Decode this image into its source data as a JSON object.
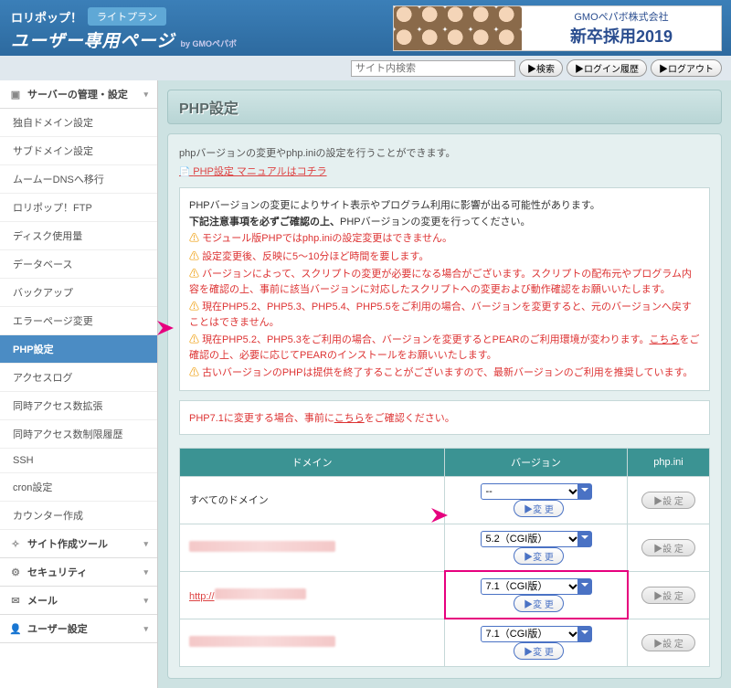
{
  "header": {
    "logo": "ロリポップ！",
    "plan": "ライトプラン",
    "subtitle": "ユーザー専用ページ",
    "byline": "by GMOペパボ"
  },
  "banner": {
    "company": "GMOペパボ株式会社",
    "title": "新卒採用2019"
  },
  "topbar": {
    "search_placeholder": "サイト内検索",
    "search_btn": "▶検索",
    "history_btn": "▶ログイン履歴",
    "logout_btn": "▶ログアウト"
  },
  "sidebar": {
    "section1": "サーバーの管理・設定",
    "items": [
      "独自ドメイン設定",
      "サブドメイン設定",
      "ムームーDNSへ移行",
      "ロリポップ！FTP",
      "ディスク使用量",
      "データベース",
      "バックアップ",
      "エラーページ変更",
      "PHP設定",
      "アクセスログ",
      "同時アクセス数拡張",
      "同時アクセス数制限履歴",
      "SSH",
      "cron設定",
      "カウンター作成"
    ],
    "section2": "サイト作成ツール",
    "section3": "セキュリティ",
    "section4": "メール",
    "section5": "ユーザー設定"
  },
  "main": {
    "title": "PHP設定",
    "desc": "phpバージョンの変更やphp.iniの設定を行うことができます。",
    "manual_link": "PHP設定 マニュアルはコチラ",
    "warning": {
      "line1": "PHPバージョンの変更によりサイト表示やプログラム利用に影響が出る可能性があります。",
      "line2a": "下記注意事項を必ずご確認の上、",
      "line2b": "PHPバージョンの変更を行ってください。",
      "w1": "モジュール版PHPではphp.iniの設定変更はできません。",
      "w2": "設定変更後、反映に5～10分ほど時間を要します。",
      "w3": "バージョンによって、スクリプトの変更が必要になる場合がございます。スクリプトの配布元やプログラム内容を確認の上、事前に該当バージョンに対応したスクリプトへの変更および動作確認をお願いいたします。",
      "w4": "現在PHP5.2、PHP5.3、PHP5.4、PHP5.5をご利用の場合、バージョンを変更すると、元のバージョンへ戻すことはできません。",
      "w5a": "現在PHP5.2、PHP5.3をご利用の場合、バージョンを変更するとPEARのご利用環境が変わります。",
      "w5link": "こちら",
      "w5b": "をご確認の上、必要に応じてPEARのインストールをお願いいたします。",
      "w6": "古いバージョンのPHPは提供を終了することがございますので、最新バージョンのご利用を推奨しています。"
    },
    "note": {
      "text1": "PHP7.1に変更する場合、事前に",
      "link": "こちら",
      "text2": "をご確認ください。"
    },
    "table": {
      "col1": "ドメイン",
      "col2": "バージョン",
      "col3": "php.ini",
      "all_domains": "すべてのドメイン",
      "http_prefix": "http://",
      "versions": {
        "blank": "--",
        "v52": "5.2（CGI版）",
        "v71": "7.1（CGI版）"
      },
      "change_btn": "▶変 更",
      "set_btn": "▶設 定"
    }
  }
}
